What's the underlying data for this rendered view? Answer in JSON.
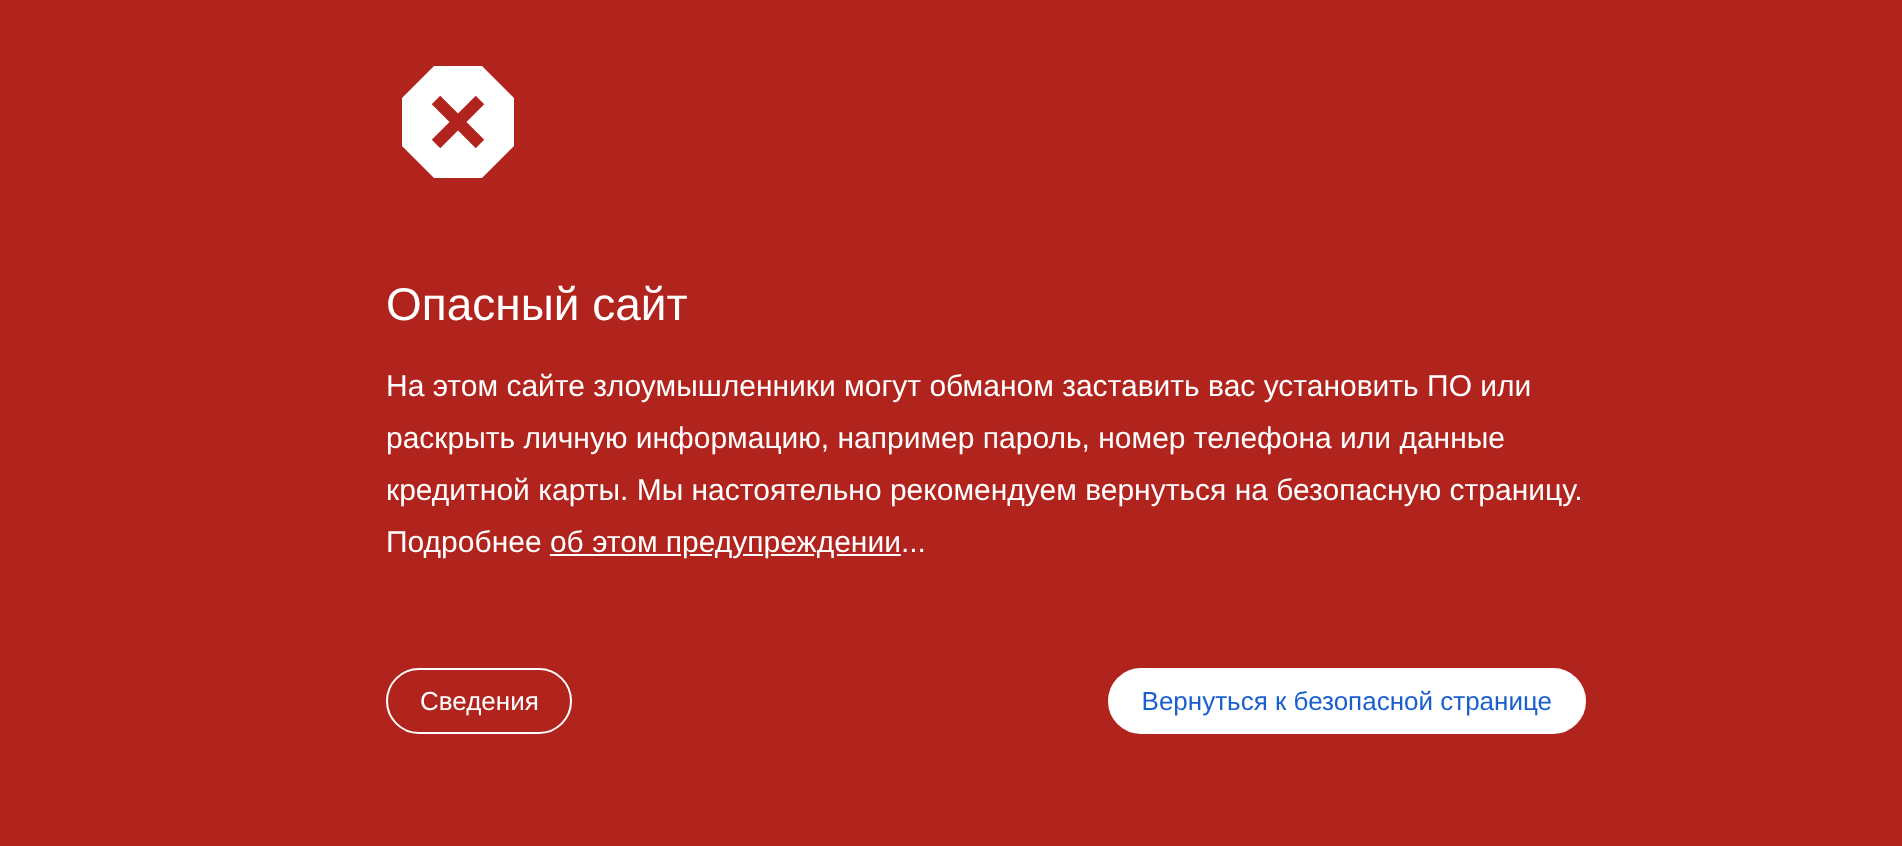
{
  "title": "Опасный сайт",
  "message": {
    "text": "На этом сайте злоумышленники могут обманом заставить вас установить ПО или раскрыть личную информацию, например пароль, номер телефона или данные кредитной карты. Мы настоятельно рекомендуем вернуться на безопасную страницу. Подробнее ",
    "link": "об этом предупреждении",
    "suffix": "..."
  },
  "buttons": [
    {
      "label": "Сведения",
      "kind": "outline"
    },
    {
      "label": "Вернуться к безопасной странице",
      "kind": "primary"
    }
  ]
}
